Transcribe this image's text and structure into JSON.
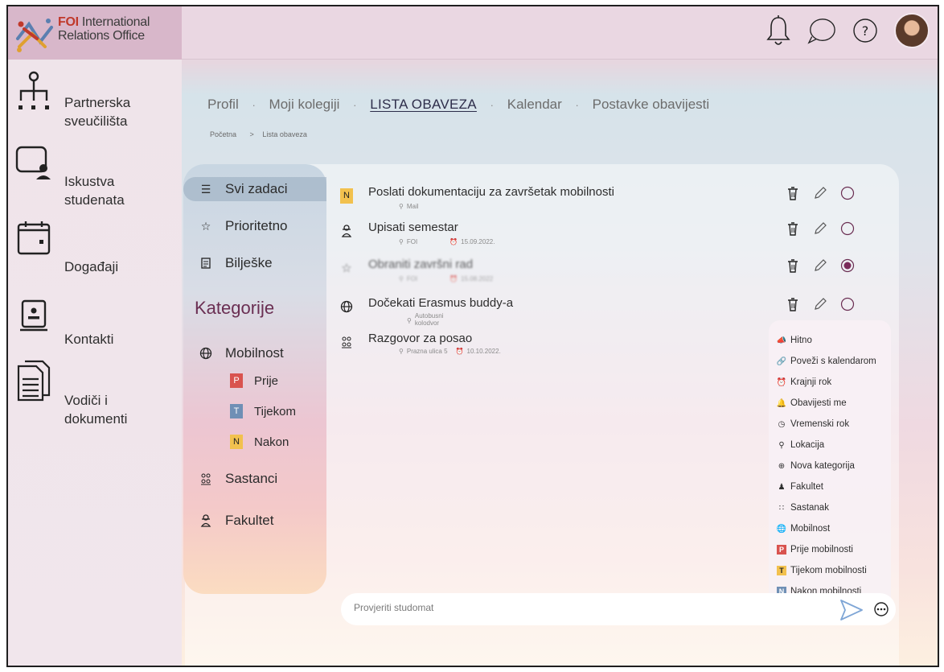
{
  "brand": {
    "name_highlight": "FOI",
    "name_rest": " International",
    "name_line2": "Relations Office"
  },
  "topbar": {
    "icons": [
      "bell-icon",
      "chat-icon",
      "help-icon",
      "avatar"
    ]
  },
  "sidebar": {
    "items": [
      {
        "label_l1": "Partnerska",
        "label_l2": "sveučilišta",
        "icon": "network-icon"
      },
      {
        "label_l1": "Iskustva",
        "label_l2": "studenata",
        "icon": "student-icon"
      },
      {
        "label_l1": "Događaji",
        "label_l2": "",
        "icon": "calendar-icon"
      },
      {
        "label_l1": "Kontakti",
        "label_l2": "",
        "icon": "contact-book-icon"
      },
      {
        "label_l1": "Vodiči i",
        "label_l2": "dokumenti",
        "icon": "documents-icon"
      }
    ]
  },
  "tabs": {
    "items": [
      "Profil",
      "Moji kolegiji",
      "LISTA OBAVEZA",
      "Kalendar",
      "Postavke obavijesti"
    ],
    "separator": "·",
    "active": "LISTA OBAVEZA"
  },
  "breadcrumb": {
    "home": "Početna",
    "separator": ">",
    "current": "Lista obaveza"
  },
  "filters": {
    "items": [
      {
        "label": "Svi zadaci",
        "icon": "list-icon",
        "active": true
      },
      {
        "label": "Prioritetno",
        "icon": "star-icon",
        "active": false
      },
      {
        "label": "Bilješke",
        "icon": "notes-icon",
        "active": false
      }
    ],
    "categories_title": "Kategorije",
    "mobilnost": {
      "label": "Mobilnost",
      "icon": "globe-icon",
      "subs": [
        {
          "badge": "P",
          "label": "Prije",
          "color": "#d9534f"
        },
        {
          "badge": "T",
          "label": "Tijekom",
          "color": "#6f8fb5"
        },
        {
          "badge": "N",
          "label": "Nakon",
          "color": "#f2c14e"
        }
      ]
    },
    "sastanci": {
      "label": "Sastanci",
      "icon": "meeting-icon"
    },
    "fakultet": {
      "label": "Fakultet",
      "icon": "faculty-icon"
    }
  },
  "tasks": [
    {
      "title": "Poslati dokumentaciju za završetak mobilnosti",
      "icon": "N",
      "location": "Mail",
      "date": "",
      "done": false
    },
    {
      "title": "Upisati semestar",
      "icon": "faculty-icon",
      "location": "FOI",
      "date": "15.09.2022.",
      "done": false
    },
    {
      "title": "Obraniti završni rad",
      "icon": "star-icon",
      "location": "FOI",
      "date": "15.08.2022",
      "done": true
    },
    {
      "title": "Dočekati Erasmus buddy-a",
      "icon": "globe-icon",
      "location": "Autobusni kolodvor",
      "date": "",
      "done": false
    },
    {
      "title": "Razgovor za posao",
      "icon": "meeting-icon",
      "location": "Prazna ulica 5",
      "date": "10.10.2022.",
      "done": false
    }
  ],
  "legend": {
    "items": [
      {
        "icon": "urgent-icon",
        "label": "Hitno"
      },
      {
        "icon": "link-icon",
        "label": "Poveži s kalendarom"
      },
      {
        "icon": "alarm-icon",
        "label": "Krajnji rok"
      },
      {
        "icon": "bell-icon",
        "label": "Obavijesti me"
      },
      {
        "icon": "clock-icon",
        "label": "Vremenski rok"
      },
      {
        "icon": "location-icon",
        "label": "Lokacija"
      },
      {
        "icon": "add-circle-icon",
        "label": "Nova kategorija"
      },
      {
        "icon": "faculty-icon",
        "label": "Fakultet"
      },
      {
        "icon": "meeting-icon",
        "label": "Sastanak"
      },
      {
        "icon": "globe-icon",
        "label": "Mobilnost"
      },
      {
        "icon": "P",
        "label": "Prije mobilnosti",
        "color": "#d9534f"
      },
      {
        "icon": "T",
        "label": "Tijekom mobilnosti",
        "color": "#f2c14e"
      },
      {
        "icon": "N",
        "label": "Nakon mobilnosti",
        "color": "#6f8fb5"
      }
    ]
  },
  "new_task": {
    "placeholder": "Provjeriti studomat"
  },
  "colors": {
    "accent": "#6a2e52",
    "send": "#7fa6d6"
  }
}
